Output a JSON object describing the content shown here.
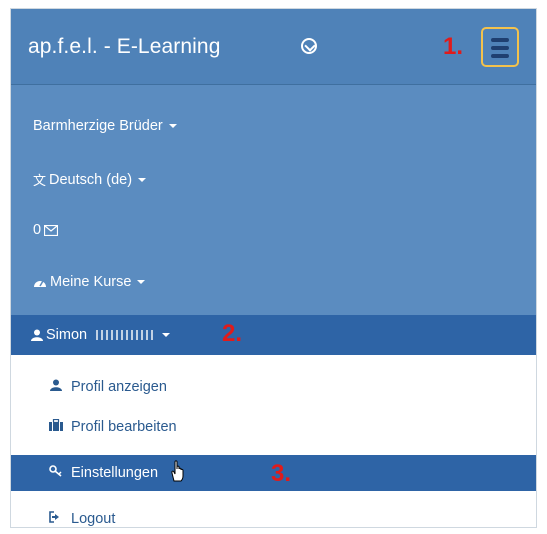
{
  "navbar": {
    "brand": "ap.f.e.l. - E-Learning",
    "download_icon": "download-circle-icon",
    "toggle_icon": "hamburger-icon",
    "annotation_1": "1.",
    "colors": {
      "navbar": "#4f82b8",
      "menu": "#5b8cc0",
      "active": "#2e64a6",
      "highlight": "#f3c24c",
      "annotation": "#e01b1b"
    }
  },
  "menu": {
    "items": [
      {
        "label": "Barmherzige Brüder",
        "icon": ""
      },
      {
        "label": "Deutsch (de)",
        "icon": "language-icon"
      },
      {
        "label": "0",
        "icon": "envelope-icon"
      },
      {
        "label": "Meine Kurse",
        "icon": "dashboard-icon"
      }
    ]
  },
  "user": {
    "label": "Simon",
    "annotation": "2."
  },
  "dropdown": {
    "items": [
      {
        "label": "Profil anzeigen",
        "icon": "user-icon"
      },
      {
        "label": "Profil bearbeiten",
        "icon": "briefcase-icon"
      },
      {
        "label": "Einstellungen",
        "icon": "key-icon"
      },
      {
        "label": "Logout",
        "icon": "sign-out-icon"
      }
    ],
    "annotation": "3."
  }
}
